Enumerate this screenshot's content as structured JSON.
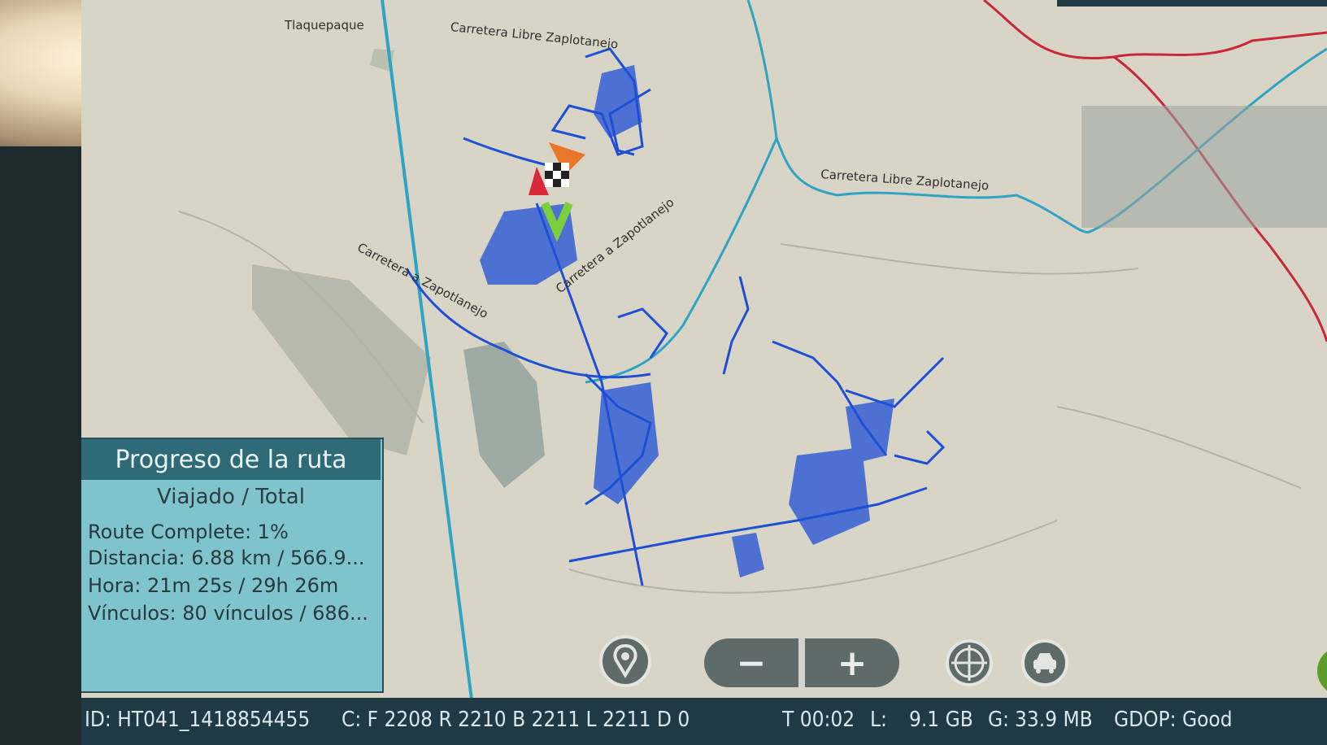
{
  "map": {
    "labels": [
      "Tlaquepaque",
      "Carretera Libre Zaplotanejo",
      "Carretera Libre Zaplotanejo",
      "Carretera a Zapotlanejo",
      "Carretera a Zapotlanejo"
    ]
  },
  "progress": {
    "title": "Progreso de la ruta",
    "subtitle": "Viajado / Total",
    "route_complete": "Route Complete: 1%",
    "distance": "Distancia: 6.88 km / 566.9...",
    "time": "Hora: 21m 25s / 29h 26m",
    "links": "Vínculos: 80 vínculos / 686..."
  },
  "controls": {
    "zoom_out": "−",
    "zoom_in": "+",
    "icons": [
      "location-pin-icon",
      "crosshair-icon",
      "car-recenter-icon"
    ]
  },
  "status": {
    "id": "ID: HT041_1418854455",
    "counts": "C: F 2208 R 2210 B 2211 L 2211 D 0",
    "time": "T 00:02",
    "storage_label": "L:",
    "storage": "9.1 GB",
    "memory_label": "G:",
    "memory": "33.9 MB",
    "gdop": "GDOP: Good"
  },
  "colors": {
    "highway": "#2fa3c4",
    "streets": "#1f4fd6",
    "red_road": "#c8283a",
    "panel_header": "#2f6b76",
    "panel_body": "#7fc3cc",
    "status_bar": "#1f3a44"
  }
}
